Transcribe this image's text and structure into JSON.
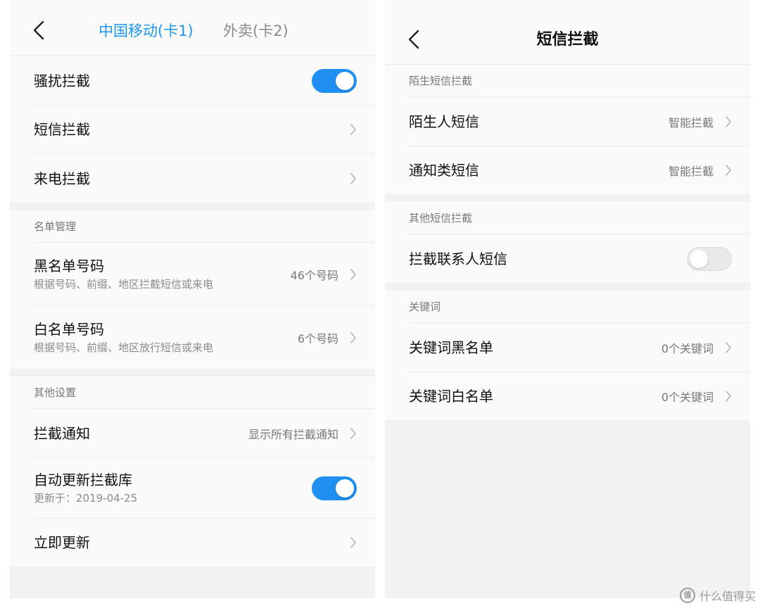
{
  "left": {
    "header": {
      "tab_active": "中国移动(卡1)",
      "tab_inactive": "外卖(卡2)"
    },
    "section1": {
      "items": [
        {
          "title": "骚扰拦截",
          "toggle": "on"
        },
        {
          "title": "短信拦截"
        },
        {
          "title": "来电拦截"
        }
      ]
    },
    "list_management": {
      "header": "名单管理",
      "items": [
        {
          "title": "黑名单号码",
          "subtitle": "根据号码、前缀、地区拦截短信或来电",
          "value": "46个号码"
        },
        {
          "title": "白名单号码",
          "subtitle": "根据号码、前缀、地区放行短信或来电",
          "value": "6个号码"
        }
      ]
    },
    "other_settings": {
      "header": "其他设置",
      "items": [
        {
          "title": "拦截通知",
          "value": "显示所有拦截通知"
        },
        {
          "title": "自动更新拦截库",
          "subtitle": "更新于：2019-04-25",
          "toggle": "on"
        },
        {
          "title": "立即更新"
        }
      ]
    }
  },
  "right": {
    "header": {
      "title": "短信拦截"
    },
    "stranger_sms": {
      "header": "陌生短信拦截",
      "items": [
        {
          "title": "陌生人短信",
          "value": "智能拦截"
        },
        {
          "title": "通知类短信",
          "value": "智能拦截"
        }
      ]
    },
    "other_sms": {
      "header": "其他短信拦截",
      "items": [
        {
          "title": "拦截联系人短信",
          "toggle": "off"
        }
      ]
    },
    "keywords": {
      "header": "关键词",
      "items": [
        {
          "title": "关键词黑名单",
          "value": "0个关键词"
        },
        {
          "title": "关键词白名单",
          "value": "0个关键词"
        }
      ]
    }
  },
  "watermark": {
    "logo": "值",
    "text": "什么值得买"
  },
  "colors": {
    "accent": "#1f96f2",
    "toggle_on": "#1f8ff2",
    "toggle_off": "#e9e9e9",
    "section_bg": "#f2f2f2"
  },
  "icons": {
    "back": "chevron-left-icon",
    "row_arrow": "chevron-right-icon"
  }
}
